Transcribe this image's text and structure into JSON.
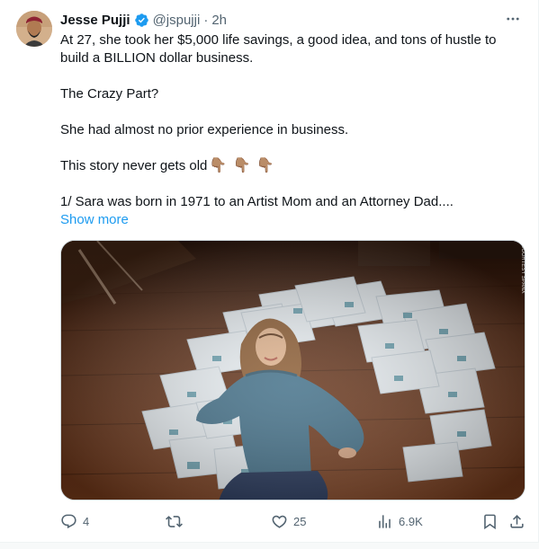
{
  "tweet": {
    "author_name": "Jesse Pujji",
    "handle": "@jspujji",
    "separator": "·",
    "time": "2h",
    "lines": [
      "At 27, she took her $5,000 life savings, a good idea, and tons of hustle to build a BILLION dollar business.",
      "The Crazy Part?",
      "She had almost no prior experience in business.",
      "This story never gets old",
      "1/ Sara was born in 1971 to an Artist Mom and an Attorney Dad...."
    ],
    "emoji": "👇🏽",
    "show_more": "Show more",
    "media_watermark": "COURTESY SPANX"
  },
  "actions": {
    "replies": "4",
    "likes": "25",
    "views": "6.9K"
  },
  "icons": {
    "verified": "verified-badge-icon",
    "more": "more-horizontal-icon",
    "reply": "reply-icon",
    "retweet": "retweet-icon",
    "like": "heart-icon",
    "views": "views-icon",
    "bookmark": "bookmark-icon",
    "share": "share-icon"
  },
  "colors": {
    "accent": "#1d9bf0",
    "text": "#0f1419",
    "muted": "#536471"
  }
}
